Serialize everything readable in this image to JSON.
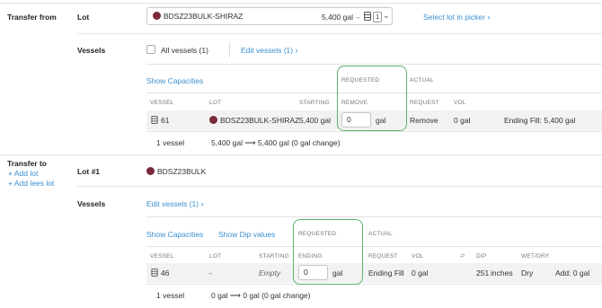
{
  "transfer_from": {
    "section_label": "Transfer from",
    "lot_label": "Lot",
    "lot_select": {
      "name": "BDSZ23BULK-SHIRAZ",
      "volume": "5,400 gal",
      "separator": "–",
      "count": "1"
    },
    "select_lot_link": "Select lot in picker",
    "vessels_label": "Vessels",
    "all_vessels_label": "All vessels (1)",
    "edit_vessels_link": "Edit vessels (1)",
    "show_capacities": "Show Capacities",
    "group_requested": "REQUESTED",
    "group_actual": "ACTUAL",
    "columns": {
      "vessel": "VESSEL",
      "lot": "LOT",
      "starting": "STARTING",
      "remove": "REMOVE",
      "request": "REQUEST",
      "vol": "VOL"
    },
    "row": {
      "vessel": "61",
      "lot": "BDSZ23BULK-SHIRAZ",
      "starting": "5,400 gal",
      "input_value": "0",
      "unit": "gal",
      "request": "Remove",
      "vol": "0 gal",
      "ending": "Ending Fill: 5,400 gal"
    },
    "footer": {
      "count": "1 vessel",
      "summary": "5,400 gal ⟶ 5,400 gal (0 gal change)"
    }
  },
  "transfer_to": {
    "section_label": "Transfer to",
    "add_lot": "Add lot",
    "add_lees_lot": "Add lees lot",
    "lot_label": "Lot #1",
    "lot_name": "BDSZ23BULK",
    "vessels_label": "Vessels",
    "edit_vessels_link": "Edit vessels (1)",
    "show_capacities": "Show Capacities",
    "show_dip": "Show Dip values",
    "group_requested": "REQUESTED",
    "group_actual": "ACTUAL",
    "columns": {
      "vessel": "VESSEL",
      "lot": "LOT",
      "starting": "STARTING",
      "ending": "ENDING",
      "request": "REQUEST",
      "vol": "VOL",
      "dip": "DIP",
      "wetdry": "WET/DRY"
    },
    "row": {
      "vessel": "46",
      "lot": "-",
      "starting": "Empty",
      "input_value": "0",
      "unit": "gal",
      "request": "Ending Fill",
      "vol": "0 gal",
      "dip": "251",
      "dip_unit": "inches",
      "wetdry": "Dry",
      "add": "Add: 0 gal"
    },
    "footer": {
      "count": "1 vessel",
      "summary": "0 gal ⟶ 0 gal (0 gal change)"
    }
  },
  "colors": {
    "accent": "#3a8fd0",
    "highlight": "#59b56b",
    "lot_dot": "#7a2a3b"
  }
}
